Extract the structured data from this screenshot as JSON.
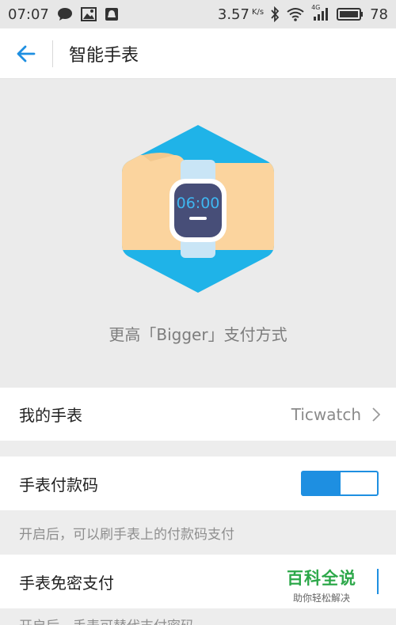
{
  "status_bar": {
    "time": "07:07",
    "speed": "3.57",
    "speed_unit": "K/s",
    "network": "4G",
    "battery": "78"
  },
  "header": {
    "title": "智能手表"
  },
  "hero": {
    "watch_time": "06:00",
    "caption": "更高「Bigger」支付方式"
  },
  "my_watch": {
    "label": "我的手表",
    "value": "Ticwatch"
  },
  "payment_code": {
    "label": "手表付款码",
    "toggle_on": true,
    "hint": "开启后，可以刷手表上的付款码支付"
  },
  "password_free": {
    "label": "手表免密支付",
    "hint": "开启后，手表可替代支付密码"
  },
  "watermark": {
    "title": "百科全说",
    "subtitle": "助你轻松解决"
  },
  "colors": {
    "accent": "#1e8fe1",
    "hex_blue": "#1fb3e8",
    "skin": "#fbd49e",
    "watch_face": "#474e78"
  }
}
